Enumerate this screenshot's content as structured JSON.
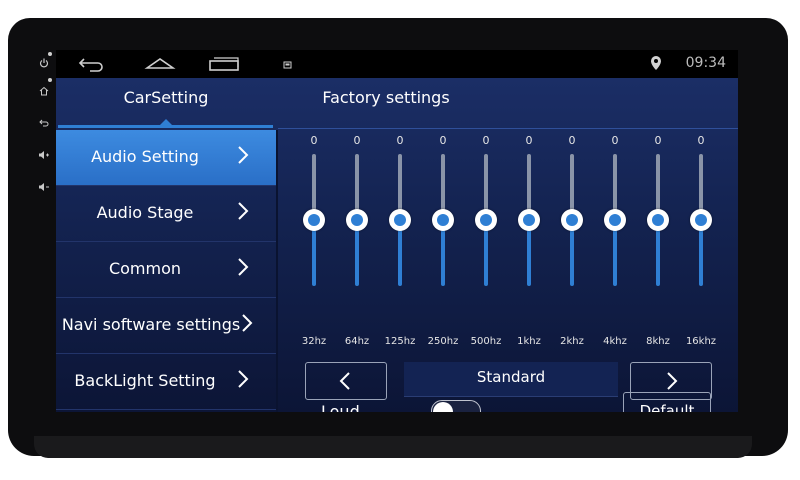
{
  "statusbar": {
    "time": "09:34",
    "icons": [
      "back-arrow-icon",
      "home-icon",
      "recent-apps-icon",
      "screenshot-icon",
      "location-pin-icon"
    ]
  },
  "side_panel": {
    "icons": [
      "power-icon",
      "home-icon",
      "back-icon",
      "volume-up-icon",
      "volume-down-icon"
    ]
  },
  "tabs": {
    "car_setting": "CarSetting",
    "factory_settings": "Factory settings"
  },
  "menu": {
    "items": [
      {
        "label": "Audio Setting",
        "active": true
      },
      {
        "label": "Audio Stage",
        "active": false
      },
      {
        "label": "Common",
        "active": false
      },
      {
        "label": "Navi software settings",
        "active": false
      },
      {
        "label": "BackLight Setting",
        "active": false
      }
    ]
  },
  "equalizer": {
    "bands": [
      {
        "freq": "32hz",
        "value": "0"
      },
      {
        "freq": "64hz",
        "value": "0"
      },
      {
        "freq": "125hz",
        "value": "0"
      },
      {
        "freq": "250hz",
        "value": "0"
      },
      {
        "freq": "500hz",
        "value": "0"
      },
      {
        "freq": "1khz",
        "value": "0"
      },
      {
        "freq": "2khz",
        "value": "0"
      },
      {
        "freq": "4khz",
        "value": "0"
      },
      {
        "freq": "8khz",
        "value": "0"
      },
      {
        "freq": "16khz",
        "value": "0"
      }
    ],
    "preset": "Standard",
    "prev_icon": "chevron-left-icon",
    "next_icon": "chevron-right-icon"
  },
  "loud": {
    "label": "Loud",
    "enabled": false
  },
  "default_button": "Default",
  "colors": {
    "accent": "#2f7fd4",
    "background": "#13224f",
    "statusbar": "#000000"
  }
}
